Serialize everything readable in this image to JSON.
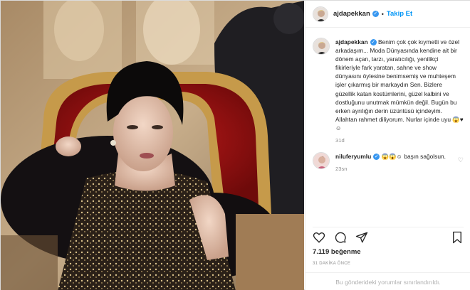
{
  "post": {
    "author": "ajdapekkan",
    "follow_label": "Takip Et",
    "dot": "•",
    "caption": "Benim çok çok kıymetli ve özel arkadaşım... Moda Dünyasında kendine ait bir dönem açan, tarzı, yaratıcılığı, yenilikçi fikirleriyle fark yaratan, sahne ve show dünyasını öylesine benimsemiş ve muhteşem işler çıkarmış bir markaydın Sen. Bizlere güzellik katan kostümlerini, güzel kalbini ve dostluğunu unutmak mümkün değil. Bugün bu erken ayrılığın derin üzüntüsü içindeyim. Allahtan rahmet diliyorum. Nurlar içinde uyu 😱♥☺",
    "caption_time": "31d",
    "likes": "7.119 beğenme",
    "time_ago": "31 DAKİKA ÖNCE",
    "comments_limited": "Bu gönderideki yorumlar sınırlandırıldı."
  },
  "comments": [
    {
      "author": "niluferyumlu",
      "text": "😱😱☺ başın sağolsun.",
      "time": "23sn"
    }
  ],
  "colors": {
    "accent": "#0095f6",
    "verified": "#3897f0",
    "muted": "#8e8e8e"
  },
  "icons": [
    "verified-badge-icon",
    "heart-icon",
    "comment-icon",
    "share-icon",
    "bookmark-icon"
  ]
}
